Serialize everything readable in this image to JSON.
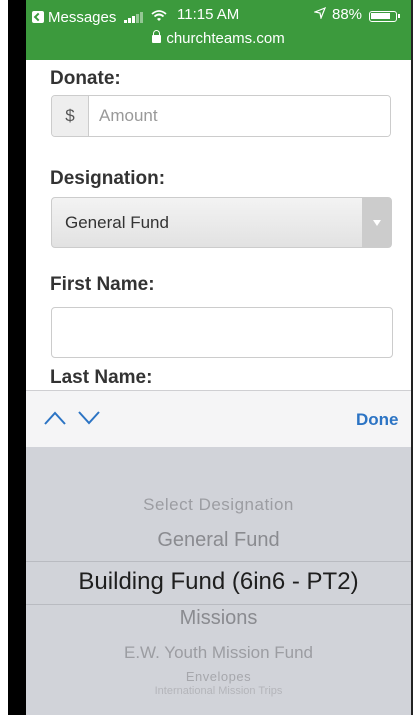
{
  "status_bar": {
    "back_app": "Messages",
    "time": "11:15 AM",
    "battery_text": "88%",
    "battery_level": 0.88,
    "url": "churchteams.com",
    "background_color": "#3c9a3d"
  },
  "form": {
    "donate_label": "Donate:",
    "currency_symbol": "$",
    "amount_placeholder": "Amount",
    "amount_value": "",
    "designation_label": "Designation:",
    "designation_value": "General Fund",
    "first_name_label": "First Name:",
    "first_name_value": "",
    "last_name_label": "Last Name:"
  },
  "toolbar": {
    "prev_icon": "chevron-up-icon",
    "next_icon": "chevron-down-icon",
    "done_label": "Done",
    "accent_color": "#2c74c4"
  },
  "picker": {
    "options": [
      "Select Designation",
      "General Fund",
      "Building Fund (6in6 - PT2)",
      "Missions",
      "E.W. Youth Mission Fund",
      "Envelopes",
      "International Mission Trips"
    ],
    "selected_index": 2
  }
}
